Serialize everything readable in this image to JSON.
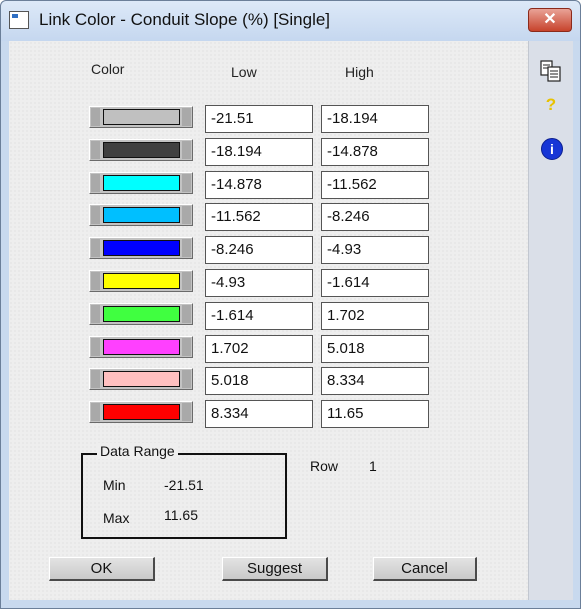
{
  "window": {
    "title": "Link Color - Conduit Slope (%) [Single]",
    "close_glyph": "✕"
  },
  "columns": {
    "color": "Color",
    "low": "Low",
    "high": "High"
  },
  "rows": [
    {
      "color": "#c0c0c0",
      "low": "-21.51",
      "high": "-18.194"
    },
    {
      "color": "#404040",
      "low": "-18.194",
      "high": "-14.878"
    },
    {
      "color": "#00ffff",
      "low": "-14.878",
      "high": "-11.562"
    },
    {
      "color": "#00bfff",
      "low": "-11.562",
      "high": "-8.246"
    },
    {
      "color": "#0000ff",
      "low": "-8.246",
      "high": "-4.93"
    },
    {
      "color": "#ffff00",
      "low": "-4.93",
      "high": "-1.614"
    },
    {
      "color": "#40ff40",
      "low": "-1.614",
      "high": "1.702"
    },
    {
      "color": "#ff40ff",
      "low": "1.702",
      "high": "5.018"
    },
    {
      "color": "#ffc0c0",
      "low": "5.018",
      "high": "8.334"
    },
    {
      "color": "#ff0000",
      "low": "8.334",
      "high": "11.65"
    }
  ],
  "data_range": {
    "label": "Data Range",
    "min_label": "Min",
    "min_value": "-21.51",
    "max_label": "Max",
    "max_value": "11.65"
  },
  "row_indicator": {
    "label": "Row",
    "value": "1"
  },
  "buttons": {
    "ok": "OK",
    "suggest": "Suggest",
    "cancel": "Cancel"
  },
  "toolbar": {
    "copy_icon": "copy-icon",
    "help_glyph": "?",
    "info_glyph": "i"
  }
}
